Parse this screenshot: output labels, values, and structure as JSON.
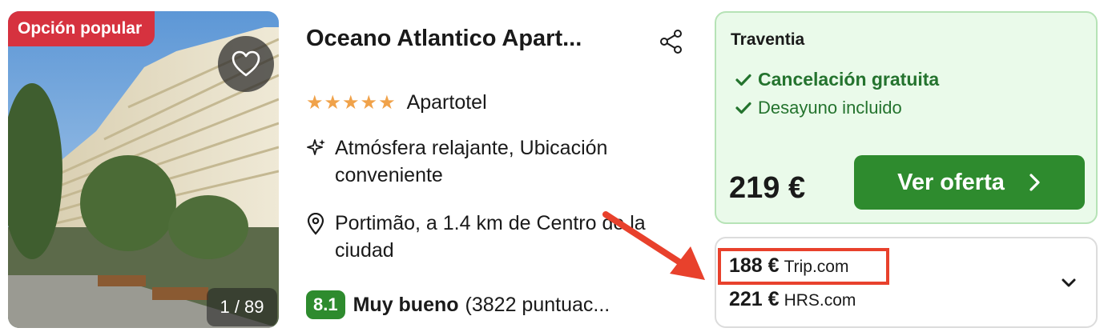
{
  "badge": {
    "label": "Opción popular"
  },
  "gallery": {
    "counter": "1 / 89"
  },
  "hotel": {
    "name": "Oceano Atlantico Apart...",
    "stars": 5,
    "type": "Apartotel",
    "highlights": "Atmósfera relajante, Ubicación conveniente",
    "location": "Portimão, a 1.4 km de Centro de la ciudad",
    "rating": {
      "score": "8.1",
      "label": "Muy bueno",
      "count": "(3822 puntuac..."
    }
  },
  "offer": {
    "provider": "Traventia",
    "perks": [
      "Cancelación gratuita",
      "Desayuno incluido"
    ],
    "price": "219 €",
    "cta_label": "Ver oferta"
  },
  "alternatives": [
    {
      "price": "188 €",
      "site": "Trip.com"
    },
    {
      "price": "221 €",
      "site": "HRS.com"
    }
  ],
  "icons": {
    "favorite": "heart-icon",
    "share": "share-icon",
    "highlights": "sparkle-icon",
    "location": "map-pin-icon",
    "check": "check-icon",
    "cta": "chevron-right-icon",
    "expand": "chevron-down-icon"
  },
  "colors": {
    "badge": "#d6323f",
    "star": "#f0a24a",
    "primary_green": "#2e8b2e",
    "offer_bg": "#eafaea",
    "annotation_red": "#e8412c"
  }
}
